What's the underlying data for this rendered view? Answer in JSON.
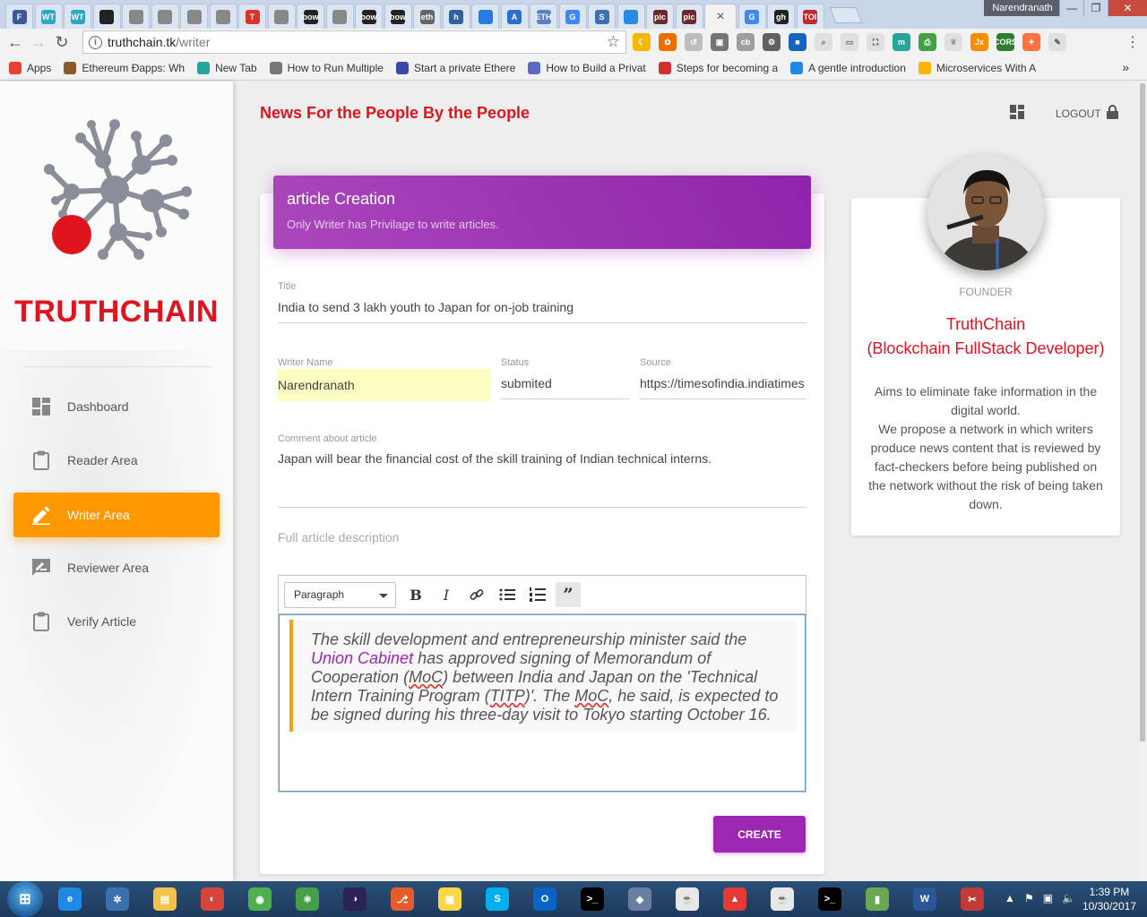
{
  "browser": {
    "tabs": [
      {
        "icon": "F",
        "color": "#3b5998"
      },
      {
        "icon": "WT",
        "color": "#2aa9c2"
      },
      {
        "icon": "WT",
        "color": "#2aa9c2"
      },
      {
        "icon": "github",
        "color": "#222222"
      },
      {
        "icon": "ether",
        "color": "#888888"
      },
      {
        "icon": "wiki",
        "color": "#888888"
      },
      {
        "icon": "ether",
        "color": "#888888"
      },
      {
        "icon": "ether",
        "color": "#888888"
      },
      {
        "icon": "T",
        "color": "#d9342b"
      },
      {
        "icon": "ether",
        "color": "#888888"
      },
      {
        "icon": "bow",
        "color": "#222222"
      },
      {
        "icon": "ether",
        "color": "#888888"
      },
      {
        "icon": "bow",
        "color": "#222222"
      },
      {
        "icon": "bow",
        "color": "#222222"
      },
      {
        "icon": "eth",
        "color": "#666666"
      },
      {
        "icon": "h",
        "color": "#345ea2"
      },
      {
        "icon": "circle",
        "color": "#2a7ae2"
      },
      {
        "icon": "A",
        "color": "#2a6fd1"
      },
      {
        "icon": "ETH",
        "color": "#5a7fc8"
      },
      {
        "icon": "G",
        "color": "#4285f4"
      },
      {
        "icon": "S",
        "color": "#3d6fb5"
      },
      {
        "icon": "snow",
        "color": "#2a8ae2"
      },
      {
        "icon": "pic",
        "color": "#6a2a2a"
      },
      {
        "icon": "pic",
        "color": "#6a2a2a"
      }
    ],
    "active_tab": {
      "icon": "close",
      "label": "×"
    },
    "tabs_after": [
      {
        "icon": "G",
        "color": "#4285f4"
      },
      {
        "icon": "gh",
        "color": "#222222"
      },
      {
        "icon": "TOI",
        "color": "#c1272d"
      }
    ],
    "profile_name": "Narendranath",
    "address": {
      "host": "truthchain.tk",
      "path": "/writer"
    },
    "bookmarks": [
      {
        "label": "Apps",
        "color": "#e94235"
      },
      {
        "label": "Ethereum Ðapps: Wh",
        "color": "#8b5a2b"
      },
      {
        "label": "New Tab",
        "color": "#26a69a"
      },
      {
        "label": "How to Run Multiple",
        "color": "#777777"
      },
      {
        "label": "Start a private Ethere",
        "color": "#3949ab"
      },
      {
        "label": "How to Build a Privat",
        "color": "#5c6bc0"
      },
      {
        "label": "Steps for becoming a",
        "color": "#d32f2f"
      },
      {
        "label": "A gentle introduction",
        "color": "#1e88e5"
      },
      {
        "label": "Microservices With A",
        "color": "#ffb300"
      }
    ],
    "more_bookmarks": "»"
  },
  "sidebar": {
    "brand": "TRUTHCHAIN",
    "items": [
      {
        "label": "Dashboard",
        "icon": "dashboard-icon"
      },
      {
        "label": "Reader Area",
        "icon": "clipboard-icon"
      },
      {
        "label": "Writer Area",
        "icon": "pencil-icon"
      },
      {
        "label": "Reviewer Area",
        "icon": "rate-review-icon"
      },
      {
        "label": "Verify Article",
        "icon": "clipboard-icon"
      }
    ],
    "active_index": 2
  },
  "header": {
    "title": "News For the People By the People",
    "logout_label": "LOGOUT"
  },
  "form": {
    "card_title": "article Creation",
    "card_subtitle": "Only Writer has Privilage to write articles.",
    "title_label": "Title",
    "title_value": "India to send 3 lakh youth to Japan for on-job training",
    "writer_label": "Writer Name",
    "writer_value": "Narendranath",
    "status_label": "Status",
    "status_value": "submited",
    "source_label": "Source",
    "source_value": "https://timesofindia.indiatimes",
    "comment_label": "Comment about article",
    "comment_value": "Japan will bear the financial cost of the skill training of Indian technical interns.",
    "description_label": "Full article description",
    "editor": {
      "format": "Paragraph",
      "quote_parts": [
        "The skill development and entrepreneurship minister said the ",
        "Union Cabinet",
        " has approved signing of Memorandum of Cooperation (",
        "MoC",
        ") between India and Japan on the 'Technical Intern Training Program (",
        "TITP",
        ")'. The ",
        "MoC",
        ", he said, is expected to be signed during his three-day visit to Tokyo starting October 16."
      ]
    },
    "create_label": "CREATE"
  },
  "profile": {
    "role": "FOUNDER",
    "name_line1": "TruthChain",
    "name_line2": "(Blockchain FullStack Developer)",
    "description": "Aims to eliminate fake information in the digital world.\nWe propose a network in which writers produce news content that is reviewed by fact-checkers before being published on the network without the risk of being taken down."
  },
  "taskbar": {
    "apps": [
      {
        "icon": "ie-icon",
        "color": "#1e88e5",
        "glyph": "e"
      },
      {
        "icon": "sourcetree-icon",
        "color": "#3a6fb0",
        "glyph": "✲"
      },
      {
        "icon": "explorer-icon",
        "color": "#f3c24a",
        "glyph": "▤"
      },
      {
        "icon": "swirl-icon",
        "color": "#d6453d",
        "glyph": "◐"
      },
      {
        "icon": "chrome-icon",
        "color": "#4caf50",
        "glyph": "◉"
      },
      {
        "icon": "atom-icon",
        "color": "#43a047",
        "glyph": "⚛"
      },
      {
        "icon": "eclipse-icon",
        "color": "#2c2255",
        "glyph": "◑"
      },
      {
        "icon": "git-icon",
        "color": "#e65a2c",
        "glyph": "⎇"
      },
      {
        "icon": "notes-icon",
        "color": "#fbd54a",
        "glyph": "▦"
      },
      {
        "icon": "skype-icon",
        "color": "#00aff0",
        "glyph": "S"
      },
      {
        "icon": "outlook-icon",
        "color": "#0a64c8",
        "glyph": "O"
      },
      {
        "icon": "cmd-icon",
        "color": "#000000",
        "glyph": ">_"
      },
      {
        "icon": "app-icon",
        "color": "#6a7fa0",
        "glyph": "◆"
      },
      {
        "icon": "java-icon",
        "color": "#e8e8e8",
        "glyph": "☕"
      },
      {
        "icon": "pdf-icon",
        "color": "#e53935",
        "glyph": "▲"
      },
      {
        "icon": "java2-icon",
        "color": "#e8e8e8",
        "glyph": "☕"
      },
      {
        "icon": "cmd2-icon",
        "color": "#000000",
        "glyph": ">_"
      },
      {
        "icon": "gitbash-icon",
        "color": "#6aa84f",
        "glyph": "▮"
      },
      {
        "icon": "word-icon",
        "color": "#2b579a",
        "glyph": "W"
      },
      {
        "icon": "snip-icon",
        "color": "#c23b3b",
        "glyph": "✂"
      }
    ],
    "time": "1:39 PM",
    "date": "10/30/2017"
  }
}
